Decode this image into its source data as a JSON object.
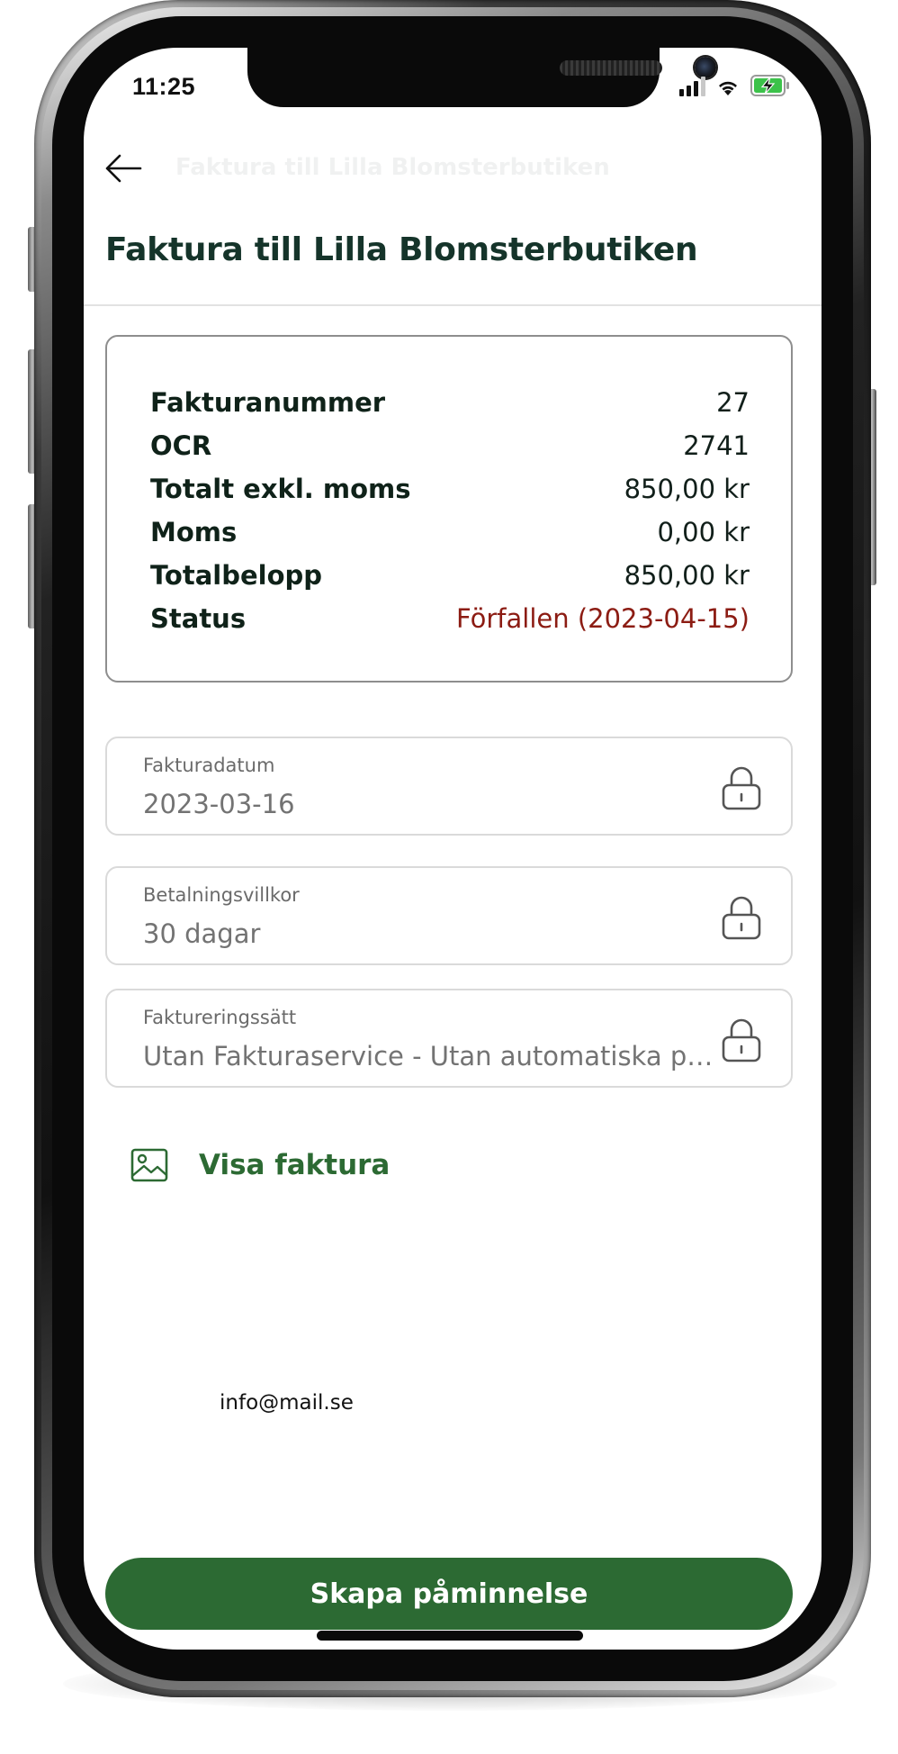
{
  "status_bar": {
    "time": "11:25"
  },
  "header": {
    "collapsed_title": "Faktura till Lilla Blomsterbutiken",
    "title": "Faktura till Lilla Blomsterbutiken"
  },
  "summary": {
    "rows": [
      {
        "label": "Fakturanummer",
        "value": "27"
      },
      {
        "label": "OCR",
        "value": "2741"
      },
      {
        "label": "Totalt exkl. moms",
        "value": "850,00 kr"
      },
      {
        "label": "Moms",
        "value": "0,00 kr"
      },
      {
        "label": "Totalbelopp",
        "value": "850,00 kr"
      },
      {
        "label": "Status",
        "value": "Förfallen (2023-04-15)"
      }
    ]
  },
  "fields": [
    {
      "label": "Fakturadatum",
      "value": "2023-03-16"
    },
    {
      "label": "Betalningsvillkor",
      "value": "30 dagar"
    },
    {
      "label": "Faktureringssätt",
      "value": "Utan Fakturaservice - Utan automatiska påminnelser"
    }
  ],
  "show_invoice": {
    "label": "Visa faktura"
  },
  "contact": {
    "email": "info@mail.se"
  },
  "cta": {
    "label": "Skapa påminnelse"
  },
  "colors": {
    "brand_green": "#2c6a33",
    "title_dark_green": "#15342a",
    "overdue_red": "#8c1c13"
  },
  "icons": {
    "back": "arrow-left-icon",
    "lock": "lock-icon",
    "image": "image-icon",
    "signal": "cellular-signal-icon",
    "wifi": "wifi-icon",
    "battery": "battery-charging-icon"
  }
}
